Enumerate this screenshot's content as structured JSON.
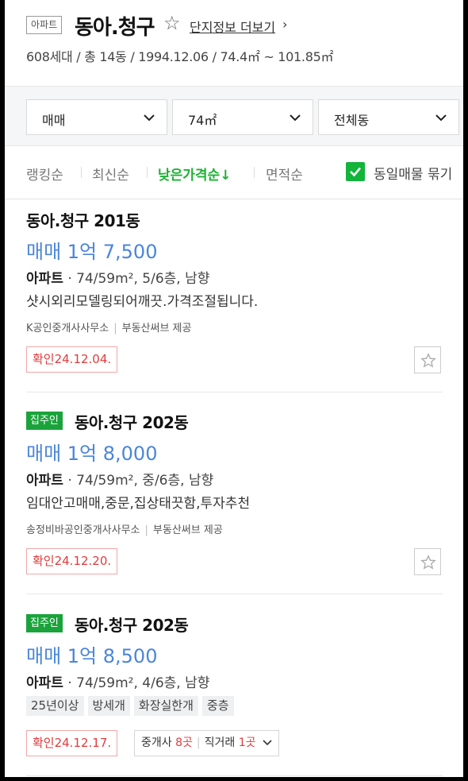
{
  "complex": {
    "type_badge": "아파트",
    "name": "동아.청구",
    "more_link": "단지정보 더보기",
    "summary": "608세대 / 총 14동 / 1994.12.06 / 74.4㎡ ~ 101.85㎡"
  },
  "filters": {
    "trade_type": "매매",
    "area": "74㎡",
    "building": "전체동"
  },
  "sort": {
    "options": [
      "랭킹순",
      "최신순",
      "낮은가격순↓",
      "면적순"
    ],
    "active": "낮은가격순↓",
    "group_same_label": "동일매물 묶기",
    "group_same_checked": true
  },
  "listings": [
    {
      "owner_badge": "",
      "title": "동아.청구 201동",
      "price": "매매 1억 7,500",
      "spec_type": "아파트",
      "spec_detail": "· 74/59m², 5/6층, 남향",
      "description": "샷시외리모델링되어깨끗.가격조절됩니다.",
      "agency": "K공인중개사사무소",
      "provider": "부동산써브 제공",
      "confirmed": "확인24.12.04."
    },
    {
      "owner_badge": "집주인",
      "title": "동아.청구 202동",
      "price": "매매 1억 8,000",
      "spec_type": "아파트",
      "spec_detail": "· 74/59m², 중/6층, 남향",
      "description": "임대안고매매,중문,집상태끗함,투자추천",
      "agency": "송정비바공인중개사사무소",
      "provider": "부동산써브 제공",
      "confirmed": "확인24.12.20."
    },
    {
      "owner_badge": "집주인",
      "title": "동아.청구 202동",
      "price": "매매 1억 8,500",
      "spec_type": "아파트",
      "spec_detail": "· 74/59m², 4/6층, 남향",
      "tags": [
        "25년이상",
        "방세개",
        "화장실한개",
        "중층"
      ],
      "confirmed": "확인24.12.17.",
      "brokers_label": "중개사",
      "brokers_count": "8곳",
      "direct_label": "직거래",
      "direct_count": "1곳"
    }
  ],
  "colors": {
    "accent_green": "#1db233",
    "price_blue": "#4a86d9",
    "confirm_red": "#e03b3b"
  }
}
